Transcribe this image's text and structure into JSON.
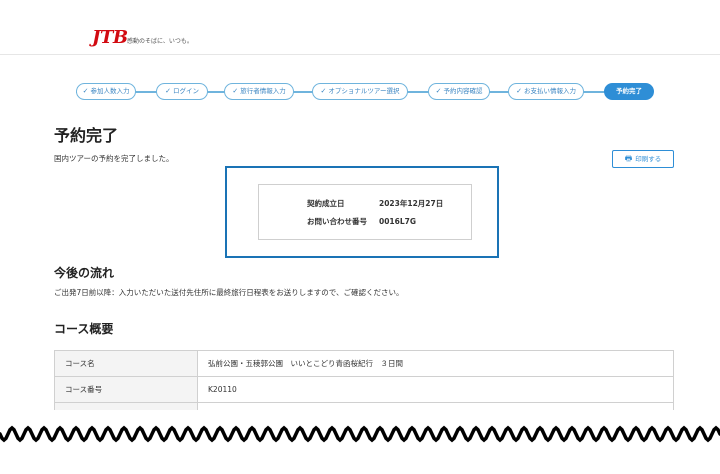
{
  "header": {
    "logo_text": "JTB",
    "tagline": "感動のそばに、いつも。"
  },
  "progress_steps": [
    {
      "label": "参加人数入力",
      "done": true
    },
    {
      "label": "ログイン",
      "done": true
    },
    {
      "label": "旅行者情報入力",
      "done": true
    },
    {
      "label": "オプショナルツアー選択",
      "done": true
    },
    {
      "label": "予約内容確認",
      "done": true
    },
    {
      "label": "お支払い情報入力",
      "done": true
    },
    {
      "label": "予約完了",
      "done": false,
      "active": true
    }
  ],
  "page": {
    "title": "予約完了",
    "message": "国内ツアーの予約を完了しました。",
    "print_button": "印刷する"
  },
  "result": {
    "contract_date_label": "契約成立日",
    "contract_date_value": "2023年12月27日",
    "inquiry_label": "お問い合わせ番号",
    "inquiry_value": "0016L7G"
  },
  "next_steps": {
    "title": "今後の流れ",
    "text": "ご出発7日前以降：入力いただいた送付先住所に最終旅行日程表をお送りしますので、ご確認ください。"
  },
  "course": {
    "title": "コース概要",
    "rows": [
      {
        "label": "コース名",
        "value": "弘前公園・五稜郭公園　いいとこどり青函桜紀行　３日間"
      },
      {
        "label": "コース番号",
        "value": "K20110"
      }
    ]
  },
  "colors": {
    "brand_red": "#d20a11",
    "accent_blue": "#2e8ed6",
    "step_border": "#6fb4dd",
    "highlight_border": "#1a73b5"
  }
}
